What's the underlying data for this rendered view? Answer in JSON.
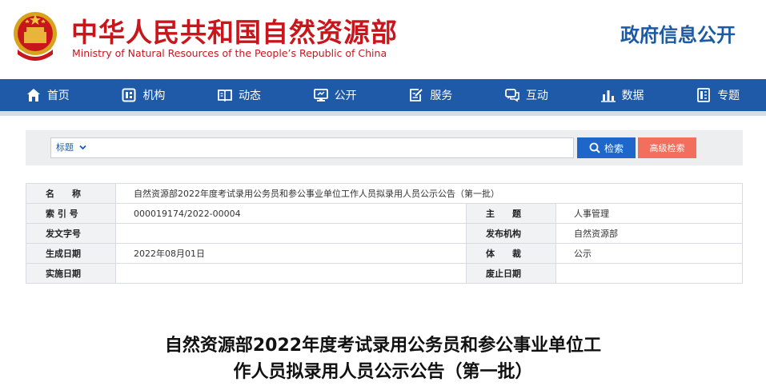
{
  "header": {
    "title_cn": "中华人民共和国自然资源部",
    "title_en": "Ministry of Natural Resources of the People’s Republic of China",
    "section": "政府信息公开",
    "brand_color": "#c8161d",
    "accent_color": "#1e5aa8"
  },
  "nav": {
    "items": [
      {
        "label": "首页",
        "icon": "home-icon"
      },
      {
        "label": "机构",
        "icon": "org-icon"
      },
      {
        "label": "动态",
        "icon": "book-icon"
      },
      {
        "label": "公开",
        "icon": "monitor-icon"
      },
      {
        "label": "服务",
        "icon": "edit-icon"
      },
      {
        "label": "互动",
        "icon": "chat-icon"
      },
      {
        "label": "数据",
        "icon": "bar-chart-icon"
      },
      {
        "label": "专题",
        "icon": "document-icon"
      }
    ]
  },
  "search": {
    "scope": "标题",
    "value": "",
    "search_label": "检索",
    "advanced_label": "高级检索"
  },
  "info": {
    "name_label": "名　　称",
    "name_value": "自然资源部2022年度考试录用公务员和参公事业单位工作人员拟录用人员公示公告（第一批）",
    "index_label": "索 引 号",
    "index_value": "000019174/2022-00004",
    "subject_label": "主　　题",
    "subject_value": "人事管理",
    "doc_no_label": "发文字号",
    "doc_no_value": "",
    "publisher_label": "发布机构",
    "publisher_value": "自然资源部",
    "date_label": "生成日期",
    "date_value": "2022年08月01日",
    "genre_label": "体　　裁",
    "genre_value": "公示",
    "effective_label": "实施日期",
    "effective_value": "",
    "expiry_label": "废止日期",
    "expiry_value": ""
  },
  "article": {
    "title_line1": "自然资源部2022年度考试录用公务员和参公事业单位工",
    "title_line2": "作人员拟录用人员公示公告（第一批）"
  }
}
